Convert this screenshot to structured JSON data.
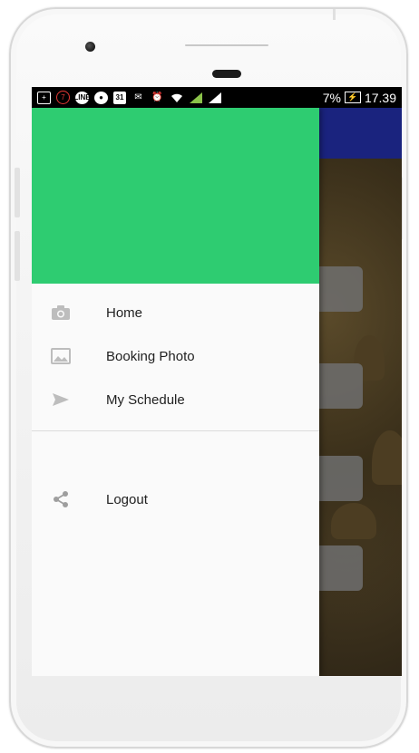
{
  "statusbar": {
    "icons": [
      "plus-box-icon",
      "notification-count-icon",
      "line-icon",
      "bbm-icon",
      "calendar-icon",
      "mail-icon",
      "alarm-icon",
      "wifi-icon",
      "signal-icon",
      "signal-icon-2"
    ],
    "notification_count": "7",
    "calendar_day": "31",
    "battery": "7%",
    "time": "17.39"
  },
  "drawer": {
    "header_color": "#2ecc71",
    "items": [
      {
        "label": "Home",
        "icon": "camera-icon"
      },
      {
        "label": "Booking Photo",
        "icon": "image-icon"
      },
      {
        "label": "My Schedule",
        "icon": "send-icon"
      }
    ],
    "secondary_items": [
      {
        "label": "Logout",
        "icon": "share-icon"
      }
    ]
  },
  "colors": {
    "appbar": "#1a237e",
    "drawer_bg": "#fafafa",
    "icon_gray": "#9e9e9e"
  }
}
